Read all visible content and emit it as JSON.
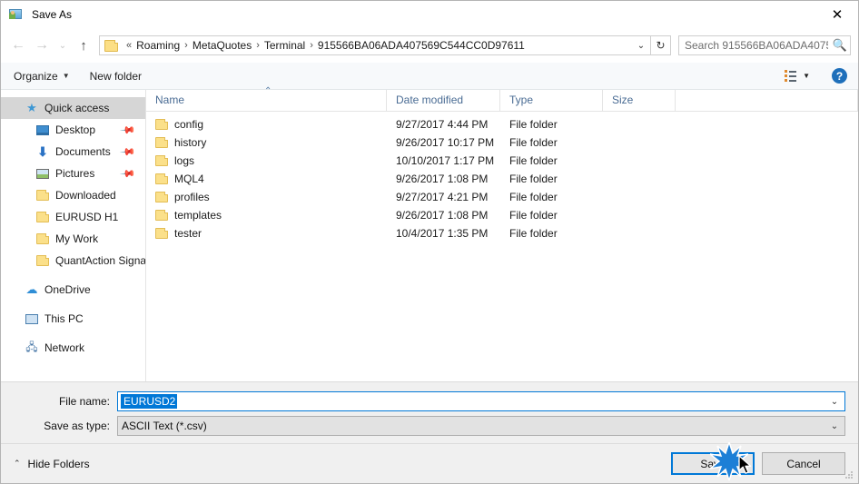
{
  "window": {
    "title": "Save As",
    "app_icon": "picture-user-icon",
    "close_label": "✕"
  },
  "nav": {
    "back_icon": "arrow-left-icon",
    "forward_icon": "arrow-right-icon",
    "history_icon": "chevron-down-icon",
    "up_icon": "arrow-up-icon",
    "breadcrumb_prefix": "«",
    "breadcrumb": [
      "Roaming",
      "MetaQuotes",
      "Terminal",
      "915566BA06ADA407569C544CC0D97611"
    ],
    "breadcrumb_dropdown_icon": "chevron-down-icon",
    "refresh_icon": "refresh-icon",
    "refresh_glyph": "↻"
  },
  "search": {
    "placeholder": "Search 915566BA06ADA40756...",
    "value": "",
    "icon": "search-icon"
  },
  "toolbar": {
    "organize_label": "Organize",
    "organize_caret": "▼",
    "new_folder_label": "New folder",
    "view_icon": "view-layout-icon",
    "view_caret": "▼",
    "help_label": "?",
    "help_icon": "help-circle-icon"
  },
  "sidebar": {
    "groups": [
      {
        "items": [
          {
            "label": "Quick access",
            "icon": "star-icon",
            "selected": true,
            "pinned": false,
            "indent": false
          },
          {
            "label": "Desktop",
            "icon": "desktop-icon",
            "selected": false,
            "pinned": true,
            "indent": true
          },
          {
            "label": "Documents",
            "icon": "documents-download-icon",
            "selected": false,
            "pinned": true,
            "indent": true
          },
          {
            "label": "Pictures",
            "icon": "pictures-icon",
            "selected": false,
            "pinned": true,
            "indent": true
          },
          {
            "label": "Downloaded",
            "icon": "folder-icon",
            "selected": false,
            "pinned": false,
            "indent": true
          },
          {
            "label": "EURUSD H1",
            "icon": "folder-icon",
            "selected": false,
            "pinned": false,
            "indent": true
          },
          {
            "label": "My Work",
            "icon": "folder-icon",
            "selected": false,
            "pinned": false,
            "indent": true
          },
          {
            "label": "QuantAction Signal",
            "icon": "folder-icon",
            "selected": false,
            "pinned": false,
            "indent": true
          }
        ]
      },
      {
        "items": [
          {
            "label": "OneDrive",
            "icon": "cloud-icon",
            "selected": false,
            "pinned": false,
            "indent": false
          }
        ]
      },
      {
        "items": [
          {
            "label": "This PC",
            "icon": "computer-icon",
            "selected": false,
            "pinned": false,
            "indent": false
          }
        ]
      },
      {
        "items": [
          {
            "label": "Network",
            "icon": "network-icon",
            "selected": false,
            "pinned": false,
            "indent": false
          }
        ]
      }
    ],
    "pin_icon": "pin-icon",
    "pin_glyph": "📌"
  },
  "filelist": {
    "columns": [
      "Name",
      "Date modified",
      "Type",
      "Size"
    ],
    "sort_column": "Name",
    "sort_caret": "⌃",
    "rows": [
      {
        "name": "config",
        "date": "9/27/2017 4:44 PM",
        "type": "File folder",
        "size": ""
      },
      {
        "name": "history",
        "date": "9/26/2017 10:17 PM",
        "type": "File folder",
        "size": ""
      },
      {
        "name": "logs",
        "date": "10/10/2017 1:17 PM",
        "type": "File folder",
        "size": ""
      },
      {
        "name": "MQL4",
        "date": "9/26/2017 1:08 PM",
        "type": "File folder",
        "size": ""
      },
      {
        "name": "profiles",
        "date": "9/27/2017 4:21 PM",
        "type": "File folder",
        "size": ""
      },
      {
        "name": "templates",
        "date": "9/26/2017 1:08 PM",
        "type": "File folder",
        "size": ""
      },
      {
        "name": "tester",
        "date": "10/4/2017 1:35 PM",
        "type": "File folder",
        "size": ""
      }
    ]
  },
  "form": {
    "filename_label": "File name:",
    "filename_value": "EURUSD2",
    "filename_dropdown_icon": "chevron-down-icon",
    "filetype_label": "Save as type:",
    "filetype_value": "ASCII Text (*.csv)",
    "filetype_dropdown_icon": "chevron-down-icon"
  },
  "footer": {
    "hide_folders_label": "Hide Folders",
    "hide_folders_caret": "⌃",
    "save_label": "Save",
    "cancel_label": "Cancel"
  },
  "colors": {
    "accent": "#0078d7",
    "titlebar_bg": "#ffffff",
    "panel_bg": "#f0f0f0",
    "command_bar_bg": "#f7f9fb",
    "selection_bg": "#d6d6d6",
    "column_header_text": "#4a6c94",
    "folder_icon": "#fbe08a"
  },
  "overlay": {
    "click_burst": "click-burst-indicator",
    "cursor": "mouse-pointer"
  }
}
